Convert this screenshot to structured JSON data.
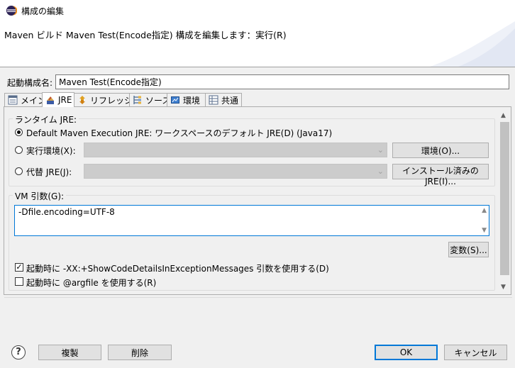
{
  "window": {
    "title": "構成の編集"
  },
  "header": {
    "message": "Maven ビルド Maven Test(Encode指定) 構成を編集します：実行(R)"
  },
  "config_name": {
    "label": "起動構成名:",
    "value": "Maven Test(Encode指定)"
  },
  "tabs": [
    {
      "label": "メイン",
      "icon": "main-tab-icon"
    },
    {
      "label": "JRE",
      "icon": "jre-icon",
      "active": true
    },
    {
      "label": "リフレッシュ",
      "icon": "refresh-icon"
    },
    {
      "label": "ソース",
      "icon": "source-icon"
    },
    {
      "label": "環境",
      "icon": "environment-icon"
    },
    {
      "label": "共通",
      "icon": "common-icon"
    }
  ],
  "runtime_jre": {
    "group_label": "ランタイム JRE:",
    "default_option": "Default Maven Execution JRE: ワークスペースのデフォルト JRE(D) (Java17)",
    "exec_env_option": "実行環境(X):",
    "exec_env_value": "",
    "env_button": "環境(O)...",
    "alt_jre_option": "代替 JRE(J):",
    "alt_jre_value": "",
    "installed_jre_button": "インストール済みの JRE(I)...",
    "selected": "default"
  },
  "vm_args": {
    "group_label": "VM 引数(G):",
    "value": "-Dfile.encoding=UTF-8",
    "variables_button": "変数(S)..."
  },
  "options": [
    {
      "label": "起動時に -XX:+ShowCodeDetailsInExceptionMessages 引数を使用する(D)",
      "checked": true
    },
    {
      "label": "起動時に @argfile を使用する(R)",
      "checked": false
    }
  ],
  "footer": {
    "duplicate_button": "複製",
    "delete_button": "削除",
    "ok_button": "OK",
    "cancel_button": "キャンセル"
  },
  "colors": {
    "accent": "#0078d7",
    "selection_border": "#0078d7"
  }
}
